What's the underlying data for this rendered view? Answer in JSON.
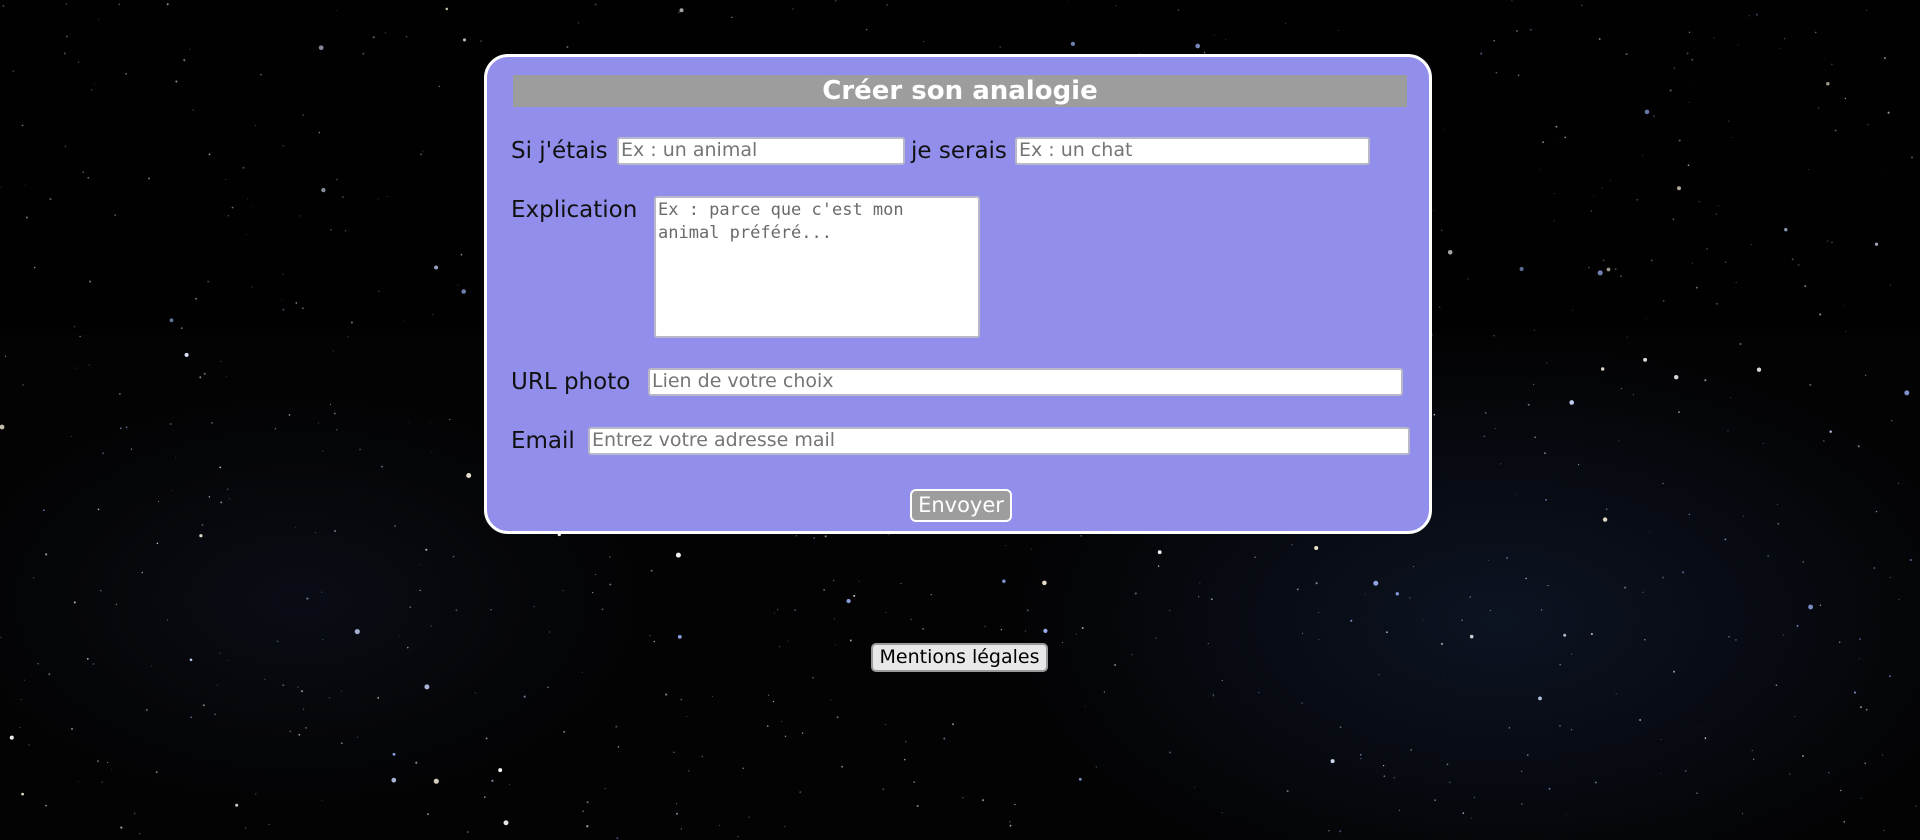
{
  "form": {
    "title": "Créer son analogie",
    "si_label": "Si j'étais",
    "si_placeholder": "Ex : un animal",
    "serais_label": "je serais",
    "serais_placeholder": "Ex : un chat",
    "explication_label": "Explication",
    "explication_placeholder": "Ex : parce que c'est mon\nanimal préféré...",
    "url_label": "URL photo",
    "url_placeholder": "Lien de votre choix",
    "email_label": "Email",
    "email_placeholder": "Entrez votre adresse mail",
    "submit_label": "Envoyer"
  },
  "footer": {
    "legal_label": "Mentions légales"
  },
  "colors": {
    "card_background": "#928eec",
    "title_bar": "#9d9d9d",
    "page_background": "#000000"
  }
}
